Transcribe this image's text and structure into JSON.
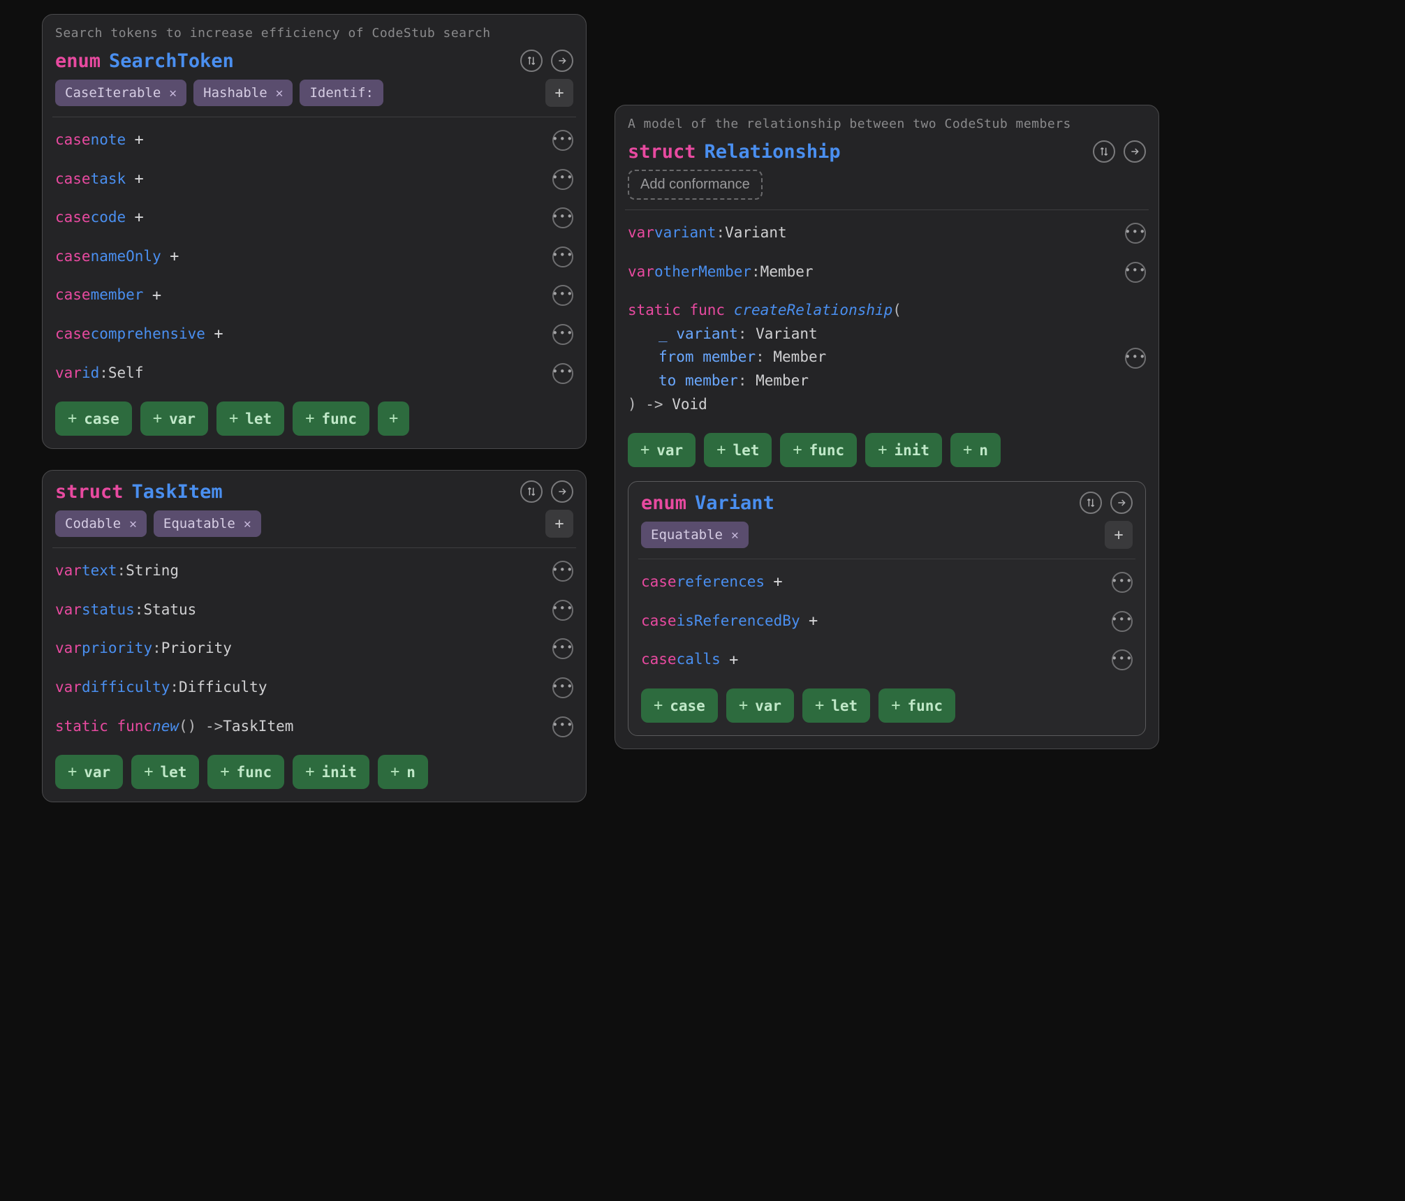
{
  "cards": {
    "searchToken": {
      "desc": "Search tokens to increase efficiency of CodeStub search",
      "keyword": "enum",
      "name": "SearchToken",
      "conformances": [
        "CaseIterable",
        "Hashable",
        "Identif:"
      ],
      "members": [
        {
          "kind": "case",
          "name": "note",
          "addable": true
        },
        {
          "kind": "case",
          "name": "task",
          "addable": true
        },
        {
          "kind": "case",
          "name": "code",
          "addable": true
        },
        {
          "kind": "case",
          "name": "nameOnly",
          "addable": true
        },
        {
          "kind": "case",
          "name": "member",
          "addable": true
        },
        {
          "kind": "case",
          "name": "comprehensive",
          "addable": true
        },
        {
          "kind": "var",
          "name": "id",
          "type": "Self"
        }
      ],
      "actions": [
        "case",
        "var",
        "let",
        "func"
      ],
      "extraPlus": true
    },
    "taskItem": {
      "keyword": "struct",
      "name": "TaskItem",
      "conformances": [
        "Codable",
        "Equatable"
      ],
      "members": [
        {
          "kind": "var",
          "name": "text",
          "type": "String"
        },
        {
          "kind": "var",
          "name": "status",
          "type": "Status"
        },
        {
          "kind": "var",
          "name": "priority",
          "type": "Priority"
        },
        {
          "kind": "var",
          "name": "difficulty",
          "type": "Difficulty"
        },
        {
          "kind": "staticfunc",
          "name": "new",
          "returns": "TaskItem"
        }
      ],
      "actions": [
        "var",
        "let",
        "func",
        "init",
        "n"
      ]
    },
    "relationship": {
      "desc": "A model of the relationship between two CodeStub members",
      "keyword": "struct",
      "name": "Relationship",
      "addConformanceLabel": "Add conformance",
      "members": [
        {
          "kind": "var",
          "name": "variant",
          "type": "Variant"
        },
        {
          "kind": "var",
          "name": "otherMember",
          "type": "Member"
        },
        {
          "kind": "staticfunc",
          "name": "createRelationship",
          "params": [
            {
              "ext": "_",
              "int": "variant",
              "type": "Variant"
            },
            {
              "ext": "from",
              "int": "member",
              "type": "Member"
            },
            {
              "ext": "to",
              "int": "member",
              "type": "Member"
            }
          ],
          "returns": "Void"
        }
      ],
      "actions": [
        "var",
        "let",
        "func",
        "init",
        "n"
      ],
      "nested": {
        "keyword": "enum",
        "name": "Variant",
        "conformances": [
          "Equatable"
        ],
        "members": [
          {
            "kind": "case",
            "name": "references",
            "addable": true
          },
          {
            "kind": "case",
            "name": "isReferencedBy",
            "addable": true
          },
          {
            "kind": "case",
            "name": "calls",
            "addable": true
          }
        ],
        "actions": [
          "case",
          "var",
          "let",
          "func"
        ]
      }
    }
  }
}
